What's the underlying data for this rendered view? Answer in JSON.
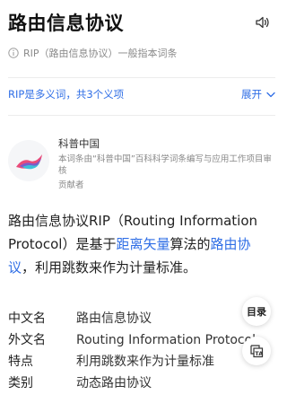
{
  "header": {
    "title": "路由信息协议",
    "speaker_icon": "speaker-icon"
  },
  "notice": {
    "text": "RIP（路由信息协议）一般指本词条",
    "icon": "info-icon"
  },
  "polysemy": {
    "text": "RIP是多义词，共3个义项",
    "expand_label": "展开",
    "expand_icon": "chevron-down-icon",
    "color": "#2f6ee6"
  },
  "contributor": {
    "name": "科普中国",
    "description": "本词条由“科普中国”百科科学词条编写与应用工作项目审核",
    "role": "贡献者",
    "logo_icon": "kepu-china-logo"
  },
  "summary": {
    "part1": "路由信息协议RIP（Routing Information Protocol）是基于",
    "link1": "距离矢量",
    "part2": "算法的",
    "link2": "路由协议",
    "part3": "，利用跳数来作为计量标准。",
    "link_color": "#2f6ee6"
  },
  "basic_info": [
    {
      "key": "中文名",
      "value": "路由信息协议"
    },
    {
      "key": "外文名",
      "value": "Routing Information Protocol"
    },
    {
      "key": "特点",
      "value": "利用跳数来作为计量标准"
    },
    {
      "key": "类别",
      "value": "动态路由协议"
    }
  ],
  "floating": {
    "toc_label": "目录",
    "translate_icon": "translate-icon"
  }
}
